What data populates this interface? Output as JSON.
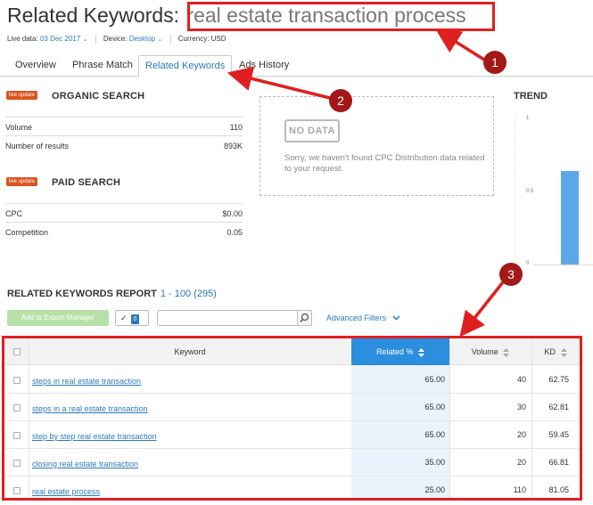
{
  "header": {
    "prefix": "Related Keywords:",
    "keyword": "real estate transaction process"
  },
  "meta": {
    "live_data_label": "Live data:",
    "live_data_value": "03 Dec 2017",
    "device_label": "Device:",
    "device_value": "Desktop",
    "currency": "Currency: USD"
  },
  "tabs": [
    "Overview",
    "Phrase Match",
    "Related Keywords",
    "Ads History"
  ],
  "organic": {
    "badge": "live update",
    "title": "ORGANIC SEARCH",
    "rows": [
      {
        "label": "Volume",
        "value": "110"
      },
      {
        "label": "Number of results",
        "value": "893K"
      }
    ]
  },
  "paid": {
    "badge": "live update",
    "title": "PAID SEARCH",
    "rows": [
      {
        "label": "CPC",
        "value": "$0.00"
      },
      {
        "label": "Competition",
        "value": "0.05"
      }
    ]
  },
  "cpc_distribution": {
    "tag": "NO DATA",
    "message": "Sorry, we haven't found CPC Distribution data related to your request."
  },
  "trend": {
    "title": "TREND",
    "y_labels": [
      "1",
      "0.5",
      "0"
    ],
    "bar_value": 0.63
  },
  "report": {
    "title": "RELATED KEYWORDS REPORT",
    "range": "1 - 100 (295)",
    "export_label": "Add to Export Manager",
    "check_mark": "✓",
    "selected_count": "0",
    "filter_placeholder": "",
    "advanced_filters": "Advanced Filters"
  },
  "table": {
    "headers": {
      "keyword": "Keyword",
      "related": "Related %",
      "volume": "Volume",
      "kd": "KD"
    },
    "rows": [
      {
        "keyword": "steps in real estate transaction",
        "related": "65.00",
        "volume": "40",
        "kd": "62.75"
      },
      {
        "keyword": "steps in a real estate transaction",
        "related": "65.00",
        "volume": "30",
        "kd": "62.81"
      },
      {
        "keyword": "step by step real estate transaction",
        "related": "65.00",
        "volume": "20",
        "kd": "59.45"
      },
      {
        "keyword": "closing real estate transaction",
        "related": "35.00",
        "volume": "20",
        "kd": "66.81"
      },
      {
        "keyword": "real estate process",
        "related": "25.00",
        "volume": "110",
        "kd": "81.05"
      }
    ]
  },
  "annotations": [
    "1",
    "2",
    "3"
  ],
  "colors": {
    "accent_blue": "#2a7ab8",
    "annotation_red": "#e02020",
    "annotation_badge": "#a31818",
    "live_badge": "#d9541e",
    "related_header": "#2b8ede"
  }
}
